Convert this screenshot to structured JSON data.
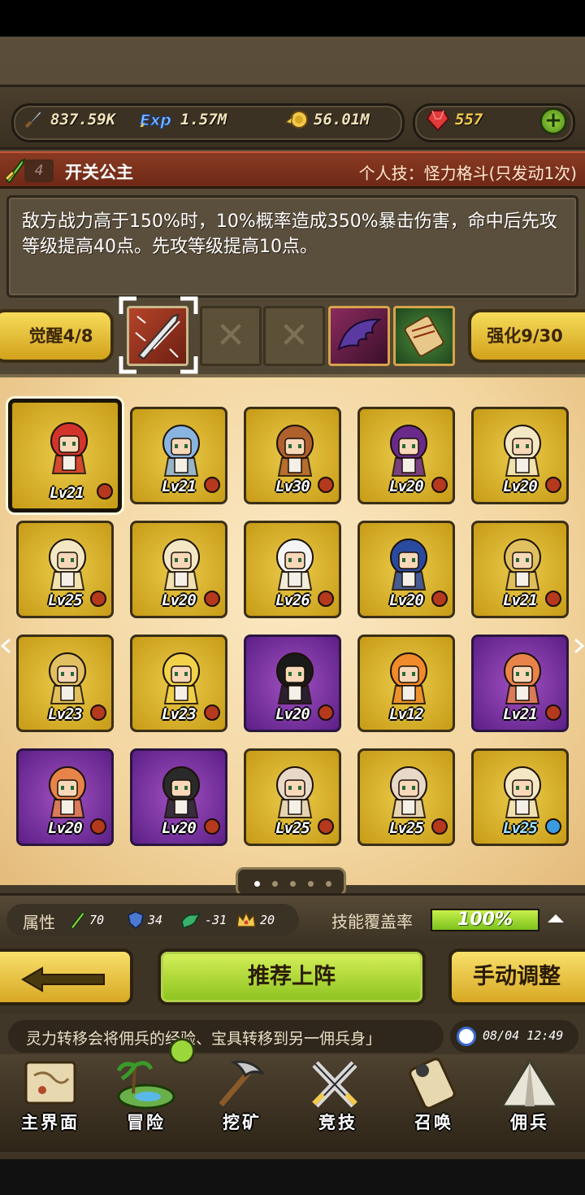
{
  "resources": {
    "attack": "837.59K",
    "exp": "1.57M",
    "gold": "56.01M",
    "gems": "557"
  },
  "banner": {
    "level": "4",
    "name": "开关公主",
    "skill": "个人技：怪力格斗(只发动1次)"
  },
  "description": "敌方战力高于150%时，10%概率造成350%暴击伤害，命中后先攻等级提高40点。先攻等级提高10点。",
  "awaken": {
    "label": "觉醒4/8"
  },
  "enhance": {
    "label": "强化9/30"
  },
  "cards": [
    {
      "lv": "Lv21",
      "color": "gold",
      "hair": "#d2342c",
      "sel": true
    },
    {
      "lv": "Lv21",
      "color": "gold",
      "hair": "#8ab4e0"
    },
    {
      "lv": "Lv30",
      "color": "gold",
      "hair": "#b0602c"
    },
    {
      "lv": "Lv20",
      "color": "gold",
      "hair": "#6a2a8a"
    },
    {
      "lv": "Lv20",
      "color": "gold",
      "hair": "#f4e8c4"
    },
    {
      "lv": "Lv25",
      "color": "gold",
      "hair": "#f4e8c4"
    },
    {
      "lv": "Lv20",
      "color": "gold",
      "hair": "#f4e8c4"
    },
    {
      "lv": "Lv26",
      "color": "gold",
      "hair": "#f4f4f4"
    },
    {
      "lv": "Lv20",
      "color": "gold",
      "hair": "#2a4aa0"
    },
    {
      "lv": "Lv21",
      "color": "gold",
      "hair": "#e0c060"
    },
    {
      "lv": "Lv23",
      "color": "gold",
      "hair": "#e0c060"
    },
    {
      "lv": "Lv23",
      "color": "gold",
      "hair": "#f2d24a"
    },
    {
      "lv": "Lv20",
      "color": "purple",
      "hair": "#1a1a1a"
    },
    {
      "lv": "Lv12",
      "color": "gold",
      "hair": "#f08a2a",
      "nodot": true
    },
    {
      "lv": "Lv21",
      "color": "purple",
      "hair": "#e8844a"
    },
    {
      "lv": "Lv20",
      "color": "purple",
      "hair": "#e8844a"
    },
    {
      "lv": "Lv20",
      "color": "purple",
      "hair": "#2a2a2a"
    },
    {
      "lv": "Lv25",
      "color": "gold",
      "hair": "#e8d8c8"
    },
    {
      "lv": "Lv25",
      "color": "gold",
      "hair": "#e8d8c8"
    },
    {
      "lv": "Lv25",
      "color": "gold",
      "hair": "#f4e8c4",
      "blue": true
    }
  ],
  "attributes": {
    "label": "属性",
    "strength": "70",
    "defense": "34",
    "dragon": "-31",
    "crown": "20"
  },
  "coverage": {
    "label": "技能覆盖率",
    "value": "100%",
    "fraction": 1.0
  },
  "buttons": {
    "recommend": "推荐上阵",
    "manual": "手动调整"
  },
  "tip": "灵力转移会将佣兵的经验、宝具转移到另一佣兵身」",
  "datetime": "08/04 12:49",
  "nav": [
    {
      "label": "主界面",
      "icon": "map-scroll-icon"
    },
    {
      "label": "冒险",
      "icon": "island-icon"
    },
    {
      "label": "挖矿",
      "icon": "pickaxe-icon"
    },
    {
      "label": "竞技",
      "icon": "crossed-swords-icon"
    },
    {
      "label": "召唤",
      "icon": "summon-scroll-icon"
    },
    {
      "label": "佣兵",
      "icon": "tent-icon"
    }
  ]
}
